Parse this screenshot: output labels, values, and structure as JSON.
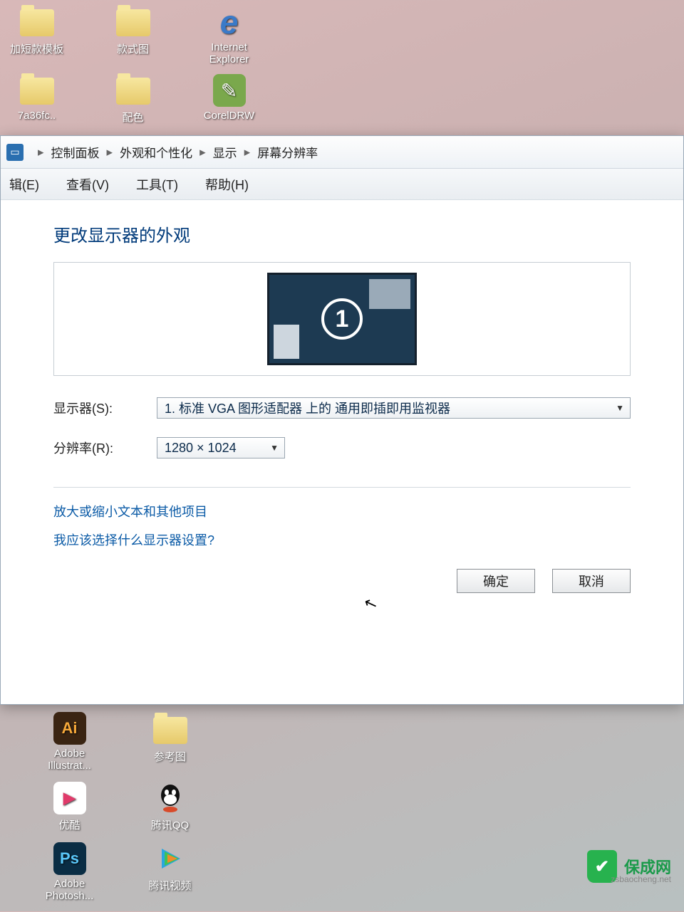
{
  "desktop": {
    "row1": [
      {
        "label": "加短款模板"
      },
      {
        "label": "款式图"
      },
      {
        "label": "Internet Explorer"
      }
    ],
    "row2": [
      {
        "label": "7a36fc.."
      },
      {
        "label": "配色"
      },
      {
        "label": "CorelDRW"
      }
    ],
    "bottom1": [
      {
        "label": "Adobe Illustrat..."
      },
      {
        "label": "参考图"
      }
    ],
    "bottom2": [
      {
        "label": "优酷"
      },
      {
        "label": "腾讯QQ"
      }
    ],
    "bottom3": [
      {
        "label": "Adobe Photosh..."
      },
      {
        "label": "腾讯视频"
      }
    ]
  },
  "breadcrumb": {
    "item1": "控制面板",
    "item2": "外观和个性化",
    "item3": "显示",
    "item4": "屏幕分辨率"
  },
  "menu": {
    "edit": "辑(E)",
    "view": "查看(V)",
    "tools": "工具(T)",
    "help": "帮助(H)"
  },
  "page": {
    "title": "更改显示器的外观",
    "monitor_number": "1",
    "display_label": "显示器(S):",
    "display_value": "1. 标准 VGA 图形适配器 上的 通用即插即用监视器",
    "resolution_label": "分辨率(R):",
    "resolution_value": "1280 × 1024",
    "link1": "放大或缩小文本和其他项目",
    "link2": "我应该选择什么显示器设置?",
    "ok": "确定",
    "cancel": "取消"
  },
  "watermark": {
    "text": "保成网",
    "sub": "zsbaocheng.net"
  }
}
